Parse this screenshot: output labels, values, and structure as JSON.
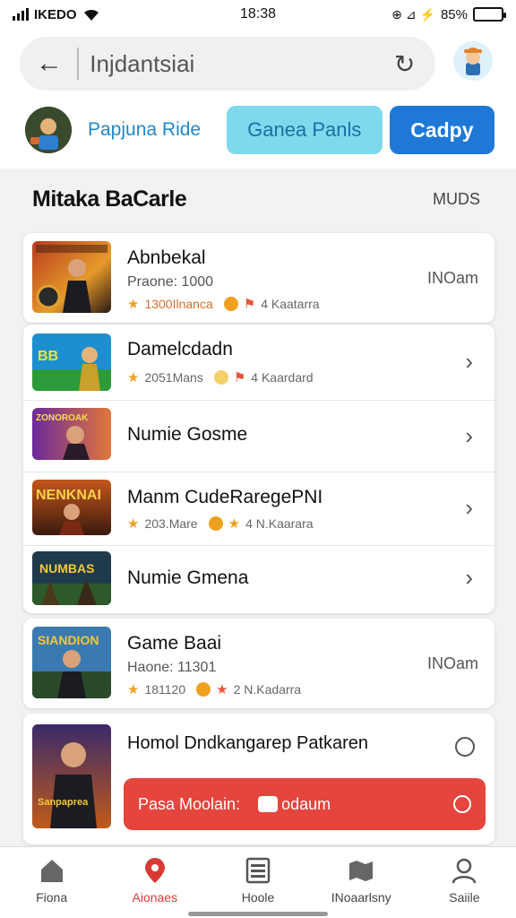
{
  "status": {
    "carrier": "IKEDO",
    "time": "18:38",
    "battery": "85%",
    "battery_level": 0.85,
    "indicators": "⊕ ⊿ ⚡"
  },
  "search": {
    "value": "Injdantsiai",
    "back_icon": "back-arrow-icon",
    "refresh_icon": "refresh-icon"
  },
  "chips": {
    "first_label": "Papjuna Ride",
    "second_label": "Ganea Panls",
    "primary_label": "Cadpy"
  },
  "section": {
    "title": "Mitaka BaCarle",
    "more": "MUDS"
  },
  "card1": {
    "title": "Abnbekal",
    "sub": "Praone: 1000",
    "rating": "1300Ilnanca",
    "players": "4 Kaatarra",
    "time": "INOam"
  },
  "card2": {
    "rows": [
      {
        "title": "Damelcdadn",
        "rating": "2051Mans",
        "players": "4 Kaardard"
      },
      {
        "title": "Numie Gosme"
      },
      {
        "title": "Manm CudeRaregePNI",
        "rating": "203.Mare",
        "players": "4 N.Kaarara"
      },
      {
        "title": "Numie Gmena"
      }
    ],
    "thumb_texts": [
      "BB",
      "ZONOROAK",
      "NENKNAI",
      "NUMBAS"
    ]
  },
  "card3": {
    "title": "Game Baai",
    "sub": "Haone: 11301",
    "rating": "181120",
    "players": "2 N.Kadarra",
    "time": "INOam",
    "thumb_text": "SIANDION"
  },
  "card4": {
    "title": "Homol Dndkangarep Patkaren",
    "promo_label": "Pasa Moolain:",
    "promo_tag": "odaum",
    "thumb_text": "Sanpaprea"
  },
  "tabs": [
    {
      "label": "Fiona",
      "icon": "home-icon"
    },
    {
      "label": "Aionaes",
      "icon": "location-pin-icon"
    },
    {
      "label": "Hoole",
      "icon": "list-icon"
    },
    {
      "label": "INoaarlsny",
      "icon": "map-icon"
    },
    {
      "label": "Saiile",
      "icon": "profile-icon"
    }
  ],
  "colors": {
    "accent": "#1f78d6",
    "chip_mid": "#7fd9ec",
    "promo": "#e5453c",
    "active_tab": "#d93a34"
  }
}
